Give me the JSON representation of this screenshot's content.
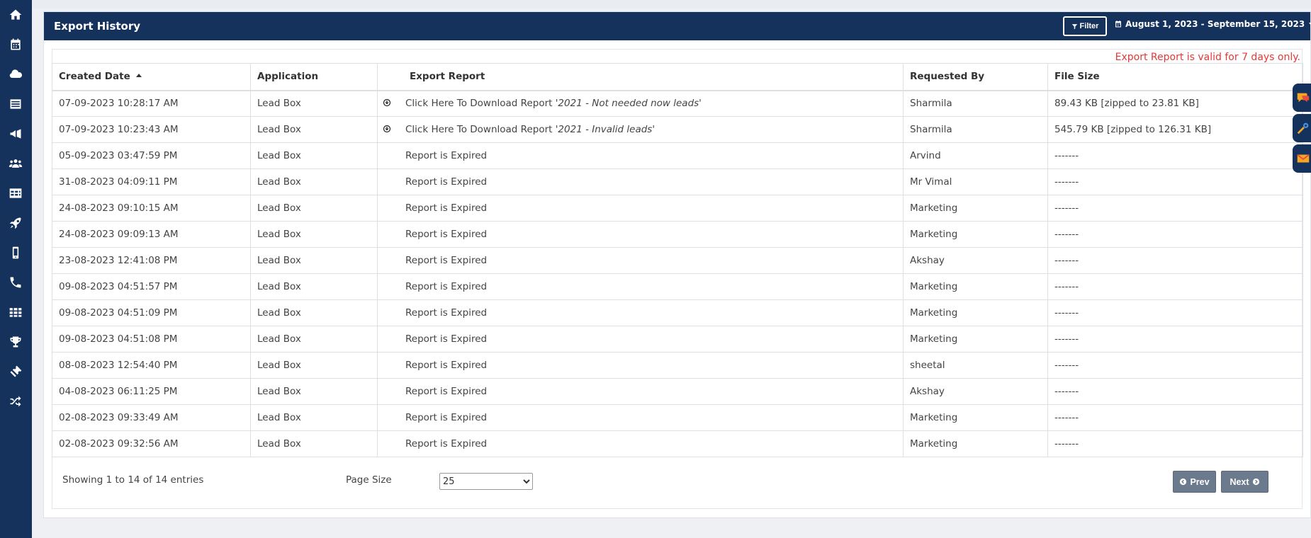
{
  "sidebar": {
    "items": [
      {
        "icon": "home-icon"
      },
      {
        "icon": "calendar-icon"
      },
      {
        "icon": "cloud-icon"
      },
      {
        "icon": "list-icon"
      },
      {
        "icon": "megaphone-icon"
      },
      {
        "icon": "users-icon"
      },
      {
        "icon": "table-icon"
      },
      {
        "icon": "rocket-icon"
      },
      {
        "icon": "mobile-icon"
      },
      {
        "icon": "phone-icon"
      },
      {
        "icon": "grid-icon"
      },
      {
        "icon": "trophy-icon"
      },
      {
        "icon": "ticket-icon"
      },
      {
        "icon": "shuffle-icon"
      }
    ]
  },
  "header": {
    "title": "Export History",
    "filter_label": "Filter",
    "date_range": "August 1, 2023 - September 15, 2023"
  },
  "note": "Export Report is valid for 7 days only.",
  "table": {
    "columns": [
      "Created Date",
      "Application",
      "Export Report",
      "Requested By",
      "File Size"
    ],
    "download_prefix": "Click Here To Download Report",
    "rows": [
      {
        "date": "07-09-2023 10:28:17 AM",
        "app": "Lead Box",
        "download": true,
        "report": "'2021 - Not needed now leads'",
        "by": "Sharmila",
        "size": "89.43 KB [zipped to 23.81 KB]"
      },
      {
        "date": "07-09-2023 10:23:43 AM",
        "app": "Lead Box",
        "download": true,
        "report": "'2021 - Invalid leads'",
        "by": "Sharmila",
        "size": "545.79 KB [zipped to 126.31 KB]"
      },
      {
        "date": "05-09-2023 03:47:59 PM",
        "app": "Lead Box",
        "download": false,
        "report": "Report is Expired",
        "by": "Arvind",
        "size": "-------"
      },
      {
        "date": "31-08-2023 04:09:11 PM",
        "app": "Lead Box",
        "download": false,
        "report": "Report is Expired",
        "by": "Mr Vimal",
        "size": "-------"
      },
      {
        "date": "24-08-2023 09:10:15 AM",
        "app": "Lead Box",
        "download": false,
        "report": "Report is Expired",
        "by": "Marketing",
        "size": "-------"
      },
      {
        "date": "24-08-2023 09:09:13 AM",
        "app": "Lead Box",
        "download": false,
        "report": "Report is Expired",
        "by": "Marketing",
        "size": "-------"
      },
      {
        "date": "23-08-2023 12:41:08 PM",
        "app": "Lead Box",
        "download": false,
        "report": "Report is Expired",
        "by": "Akshay",
        "size": "-------"
      },
      {
        "date": "09-08-2023 04:51:57 PM",
        "app": "Lead Box",
        "download": false,
        "report": "Report is Expired",
        "by": "Marketing",
        "size": "-------"
      },
      {
        "date": "09-08-2023 04:51:09 PM",
        "app": "Lead Box",
        "download": false,
        "report": "Report is Expired",
        "by": "Marketing",
        "size": "-------"
      },
      {
        "date": "09-08-2023 04:51:08 PM",
        "app": "Lead Box",
        "download": false,
        "report": "Report is Expired",
        "by": "Marketing",
        "size": "-------"
      },
      {
        "date": "08-08-2023 12:54:40 PM",
        "app": "Lead Box",
        "download": false,
        "report": "Report is Expired",
        "by": "sheetal",
        "size": "-------"
      },
      {
        "date": "04-08-2023 06:11:25 PM",
        "app": "Lead Box",
        "download": false,
        "report": "Report is Expired",
        "by": "Akshay",
        "size": "-------"
      },
      {
        "date": "02-08-2023 09:33:49 AM",
        "app": "Lead Box",
        "download": false,
        "report": "Report is Expired",
        "by": "Marketing",
        "size": "-------"
      },
      {
        "date": "02-08-2023 09:32:56 AM",
        "app": "Lead Box",
        "download": false,
        "report": "Report is Expired",
        "by": "Marketing",
        "size": "-------"
      }
    ]
  },
  "footer": {
    "showing": "Showing 1 to 14 of 14 entries",
    "page_size_label": "Page Size",
    "page_size_value": "25",
    "prev_label": "Prev",
    "next_label": "Next"
  },
  "colors": {
    "navy": "#14325b",
    "note_red": "#e53935",
    "pager_gray": "#6c7a8d"
  }
}
